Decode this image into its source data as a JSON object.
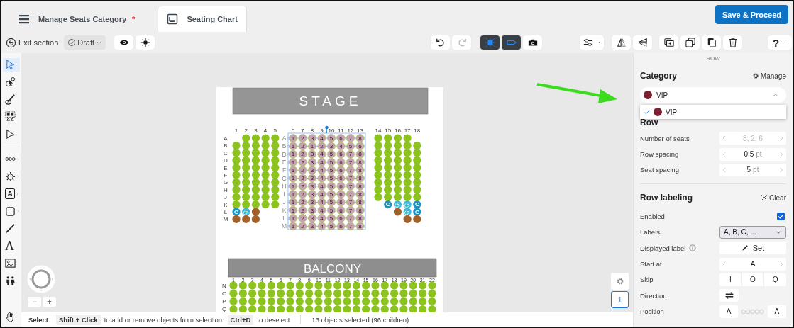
{
  "header": {
    "tabs": [
      {
        "kind": "menu",
        "label": "Manage Seats Category",
        "mark": "*",
        "selected": false
      },
      {
        "kind": "chart",
        "label": "Seating Chart",
        "selected": true
      }
    ],
    "primary_button": "Save & Proceed"
  },
  "toolbar": {
    "exit": "Exit section",
    "status": "Draft",
    "groups": [
      {
        "kind": "view",
        "buttons": [
          {
            "kind": "eye"
          },
          {
            "kind": "sun"
          }
        ]
      },
      {
        "kind": "history",
        "buttons": [
          {
            "kind": "undo",
            "disabled": false
          },
          {
            "kind": "redo",
            "disabled": true
          }
        ]
      },
      {
        "kind": "modes",
        "buttons": [
          {
            "kind": "sparkle",
            "on": true
          },
          {
            "kind": "tag",
            "on": true
          },
          {
            "kind": "camera",
            "on": false
          }
        ]
      },
      {
        "kind": "align",
        "buttons": [
          {
            "kind": "sliders",
            "dropdown": true
          }
        ]
      },
      {
        "kind": "flip",
        "buttons": [
          {
            "kind": "flip-h"
          },
          {
            "kind": "flip-v"
          }
        ]
      },
      {
        "kind": "edit",
        "buttons": [
          {
            "kind": "add-layer"
          },
          {
            "kind": "copy"
          },
          {
            "kind": "paste"
          },
          {
            "kind": "trash"
          }
        ]
      },
      {
        "kind": "help",
        "buttons": [
          {
            "kind": "help",
            "label": "?",
            "dropdown": true
          }
        ]
      }
    ]
  },
  "tools": {
    "groups": [
      [
        {
          "kind": "pointer",
          "selected": true
        },
        {
          "kind": "node",
          "selected": false
        },
        {
          "kind": "brush",
          "selected": false
        },
        {
          "kind": "seat-block",
          "selected": false
        },
        {
          "kind": "pointer-outline",
          "selected": false
        }
      ],
      [
        {
          "kind": "dots",
          "selected": false,
          "submenu": true
        },
        {
          "kind": "round-table",
          "selected": false,
          "submenu": true
        },
        {
          "kind": "text-box",
          "glyph": "A",
          "selected": false,
          "submenu": true
        },
        {
          "kind": "square",
          "selected": false,
          "submenu": true
        },
        {
          "kind": "line",
          "selected": false
        },
        {
          "kind": "text",
          "glyph": "A",
          "selected": false
        },
        {
          "kind": "image",
          "selected": false
        },
        {
          "kind": "people",
          "selected": false
        }
      ]
    ],
    "pan": {
      "kind": "hand",
      "selected": false
    }
  },
  "canvas": {
    "zoom_out": "−",
    "zoom_in": "+",
    "floor": "1"
  },
  "seating_chart": {
    "stage": "STAGE",
    "sections": [
      {
        "kind": "side",
        "columns": [
          "1",
          "2",
          "3",
          "4",
          "5"
        ],
        "rows": [
          {
            "label": "A",
            "seats": [
              {
                "kind": "empty"
              },
              {
                "kind": "open"
              },
              {
                "kind": "open"
              },
              {
                "kind": "open"
              },
              {
                "kind": "open"
              }
            ]
          },
          {
            "label": "B",
            "seats": [
              {
                "kind": "open"
              },
              {
                "kind": "open"
              },
              {
                "kind": "open"
              },
              {
                "kind": "open"
              },
              {
                "kind": "open"
              }
            ]
          },
          {
            "label": "C",
            "seats": [
              {
                "kind": "open"
              },
              {
                "kind": "open"
              },
              {
                "kind": "open"
              },
              {
                "kind": "open"
              },
              {
                "kind": "open"
              }
            ]
          },
          {
            "label": "D",
            "seats": [
              {
                "kind": "open"
              },
              {
                "kind": "open"
              },
              {
                "kind": "open"
              },
              {
                "kind": "open"
              },
              {
                "kind": "open"
              }
            ]
          },
          {
            "label": "E",
            "seats": [
              {
                "kind": "open"
              },
              {
                "kind": "open"
              },
              {
                "kind": "open"
              },
              {
                "kind": "open"
              },
              {
                "kind": "open"
              }
            ]
          },
          {
            "label": "F",
            "seats": [
              {
                "kind": "open"
              },
              {
                "kind": "open"
              },
              {
                "kind": "open"
              },
              {
                "kind": "open"
              },
              {
                "kind": "open"
              }
            ]
          },
          {
            "label": "G",
            "seats": [
              {
                "kind": "open"
              },
              {
                "kind": "open"
              },
              {
                "kind": "open"
              },
              {
                "kind": "open"
              },
              {
                "kind": "open"
              }
            ]
          },
          {
            "label": "H",
            "seats": [
              {
                "kind": "open"
              },
              {
                "kind": "open"
              },
              {
                "kind": "open"
              },
              {
                "kind": "open"
              },
              {
                "kind": "open"
              }
            ]
          },
          {
            "label": "J",
            "seats": [
              {
                "kind": "open"
              },
              {
                "kind": "open"
              },
              {
                "kind": "open"
              },
              {
                "kind": "open"
              },
              {
                "kind": "open"
              }
            ]
          },
          {
            "label": "K",
            "seats": [
              {
                "kind": "open"
              },
              {
                "kind": "open"
              },
              {
                "kind": "open"
              },
              {
                "kind": "open"
              },
              {
                "kind": "open"
              }
            ]
          },
          {
            "label": "L",
            "seats": [
              {
                "kind": "companion",
                "label": "C"
              },
              {
                "kind": "accessible"
              },
              {
                "kind": "held"
              },
              {
                "kind": "empty"
              },
              {
                "kind": "empty"
              }
            ]
          },
          {
            "label": "M",
            "seats": [
              {
                "kind": "held"
              },
              {
                "kind": "held"
              },
              {
                "kind": "held"
              },
              {
                "kind": "empty"
              },
              {
                "kind": "empty"
              }
            ]
          }
        ]
      },
      {
        "kind": "selected",
        "columns": [
          "6",
          "7",
          "8",
          "9",
          "10",
          "11",
          "12",
          "13"
        ],
        "rows": [
          {
            "label": "A",
            "seats": [
              "1",
              "2",
              "3",
              "4",
              "5",
              "6",
              "7",
              "8"
            ]
          },
          {
            "label": "B",
            "seats": [
              "1",
              "2",
              "1",
              "2",
              "3",
              "4",
              "5",
              "6"
            ]
          },
          {
            "label": "D",
            "seats": [
              "1",
              "2",
              "3",
              "4",
              "5",
              "6",
              "7",
              "8"
            ]
          },
          {
            "label": "E",
            "seats": [
              "1",
              "2",
              "3",
              "4",
              "5",
              "6",
              "7",
              "8"
            ]
          },
          {
            "label": "F",
            "seats": [
              "1",
              "2",
              "3",
              "4",
              "5",
              "6",
              "7",
              "8"
            ]
          },
          {
            "label": "G",
            "seats": [
              "1",
              "2",
              "3",
              "4",
              "5",
              "6",
              "7",
              "8"
            ]
          },
          {
            "label": "H",
            "seats": [
              "1",
              "2",
              "3",
              "4",
              "5",
              "6",
              "7",
              "8"
            ]
          },
          {
            "label": "I",
            "seats": [
              "1",
              "2",
              "3",
              "4",
              "5",
              "6",
              "7",
              "8"
            ]
          },
          {
            "label": "J",
            "seats": [
              "1",
              "2",
              "3",
              "4",
              "5",
              "6",
              "7",
              "8"
            ]
          },
          {
            "label": "K",
            "seats": [
              "1",
              "2",
              "3",
              "4",
              "5",
              "6",
              "7",
              "8"
            ]
          },
          {
            "label": "L",
            "seats": [
              "1",
              "2",
              "3",
              "4",
              "5",
              "6",
              "7",
              "8"
            ]
          },
          {
            "label": "M",
            "seats": [
              "1",
              "2",
              "3",
              "4",
              "5",
              "6",
              "7",
              "8"
            ]
          }
        ]
      },
      {
        "kind": "side",
        "columns": [
          "14",
          "15",
          "16",
          "17",
          "18"
        ],
        "rows": [
          {
            "seats": [
              {
                "kind": "open"
              },
              {
                "kind": "open"
              },
              {
                "kind": "open"
              },
              {
                "kind": "open"
              },
              {
                "kind": "empty"
              }
            ]
          },
          {
            "seats": [
              {
                "kind": "open"
              },
              {
                "kind": "open"
              },
              {
                "kind": "open"
              },
              {
                "kind": "open"
              },
              {
                "kind": "open"
              }
            ]
          },
          {
            "seats": [
              {
                "kind": "open"
              },
              {
                "kind": "open"
              },
              {
                "kind": "open"
              },
              {
                "kind": "open"
              },
              {
                "kind": "open"
              }
            ]
          },
          {
            "seats": [
              {
                "kind": "open"
              },
              {
                "kind": "open"
              },
              {
                "kind": "open"
              },
              {
                "kind": "open"
              },
              {
                "kind": "open"
              }
            ]
          },
          {
            "seats": [
              {
                "kind": "open"
              },
              {
                "kind": "open"
              },
              {
                "kind": "open"
              },
              {
                "kind": "open"
              },
              {
                "kind": "open"
              }
            ]
          },
          {
            "seats": [
              {
                "kind": "open"
              },
              {
                "kind": "open"
              },
              {
                "kind": "open"
              },
              {
                "kind": "open"
              },
              {
                "kind": "open"
              }
            ]
          },
          {
            "seats": [
              {
                "kind": "open"
              },
              {
                "kind": "open"
              },
              {
                "kind": "open"
              },
              {
                "kind": "open"
              },
              {
                "kind": "open"
              }
            ]
          },
          {
            "seats": [
              {
                "kind": "open"
              },
              {
                "kind": "open"
              },
              {
                "kind": "open"
              },
              {
                "kind": "open"
              },
              {
                "kind": "open"
              }
            ]
          },
          {
            "seats": [
              {
                "kind": "open"
              },
              {
                "kind": "open"
              },
              {
                "kind": "open"
              },
              {
                "kind": "open"
              },
              {
                "kind": "open"
              }
            ]
          },
          {
            "seats": [
              {
                "kind": "empty"
              },
              {
                "kind": "companion",
                "label": "C"
              },
              {
                "kind": "accessible"
              },
              {
                "kind": "accessible"
              },
              {
                "kind": "companion",
                "label": "C"
              }
            ]
          },
          {
            "seats": [
              {
                "kind": "empty"
              },
              {
                "kind": "empty"
              },
              {
                "kind": "held"
              },
              {
                "kind": "accessible"
              },
              {
                "kind": "companion",
                "label": "C"
              }
            ]
          },
          {
            "seats": [
              {
                "kind": "empty"
              },
              {
                "kind": "empty"
              },
              {
                "kind": "empty"
              },
              {
                "kind": "held"
              },
              {
                "kind": "held"
              }
            ]
          }
        ]
      }
    ],
    "balcony": {
      "title": "BALCONY",
      "columns": [
        "1",
        "2",
        "3",
        "4",
        "5",
        "6",
        "7",
        "8",
        "9",
        "10",
        "11",
        "12",
        "13",
        "14",
        "15",
        "16",
        "17",
        "18",
        "19",
        "20",
        "21",
        "22"
      ],
      "rows": [
        {
          "label": "N",
          "kind": "open"
        },
        {
          "label": "O",
          "kind": "open"
        },
        {
          "label": "P",
          "kind": "open"
        },
        {
          "label": "Q",
          "kind": "open"
        }
      ]
    }
  },
  "panel": {
    "heading": "ROW",
    "category": {
      "title": "Category",
      "manage": "Manage",
      "value": {
        "label": "VIP",
        "color": "#7a2032"
      },
      "expanded": true,
      "options": [
        {
          "label": "VIP",
          "color": "#7a2032",
          "selected": true
        }
      ]
    },
    "row": {
      "title": "Row",
      "fields": [
        {
          "label": "Number of seats",
          "value": "8, 2, 6",
          "disabled": true
        },
        {
          "label": "Row spacing",
          "value": "0.5",
          "unit": "pt",
          "disabled": false
        },
        {
          "label": "Seat spacing",
          "value": "5",
          "unit": "pt",
          "disabled": false
        }
      ]
    },
    "row_labeling": {
      "title": "Row labeling",
      "clear": "Clear",
      "items": [
        {
          "kind": "checkbox",
          "label": "Enabled",
          "checked": true
        },
        {
          "kind": "select",
          "label": "Labels",
          "value": "A, B, C, ..."
        },
        {
          "kind": "button",
          "label": "Displayed label",
          "info": true,
          "button": "Set"
        },
        {
          "kind": "stepper",
          "label": "Start at",
          "value": "A"
        },
        {
          "kind": "segments",
          "label": "Skip",
          "options": [
            "I",
            "O",
            "Q"
          ]
        },
        {
          "kind": "icon-button",
          "label": "Direction"
        },
        {
          "kind": "position",
          "label": "Position",
          "start": "A",
          "end": "A"
        }
      ]
    }
  },
  "status_bar": {
    "mode": "Select",
    "hints": [
      {
        "key": "Shift + Click",
        "text": "to add or remove objects from selection."
      },
      {
        "key": "Ctrl+D",
        "text": "to deselect"
      }
    ],
    "selection": "13 objects selected (96 children)"
  }
}
